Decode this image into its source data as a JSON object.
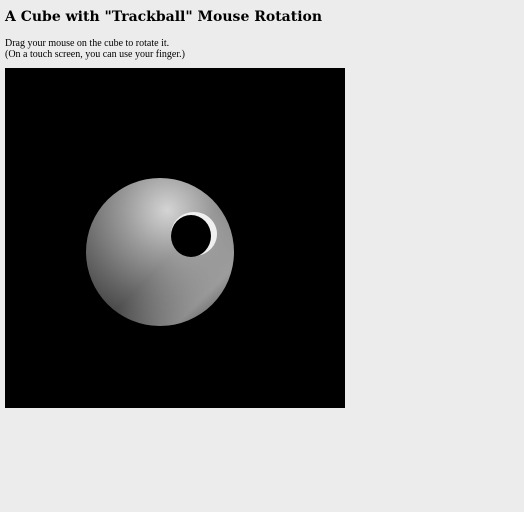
{
  "page": {
    "title": "A Cube with \"Trackball\" Mouse Rotation",
    "instruction_line1": "Drag your mouse on the cube to rotate it.",
    "instruction_line2": "(On a touch screen, you can use your finger.)"
  },
  "canvas": {
    "background_color": "#000000",
    "object_colors": {
      "highlight": "#f2f2f2",
      "midtone": "#8c8c8c",
      "shadow": "#3a3a3a"
    }
  }
}
